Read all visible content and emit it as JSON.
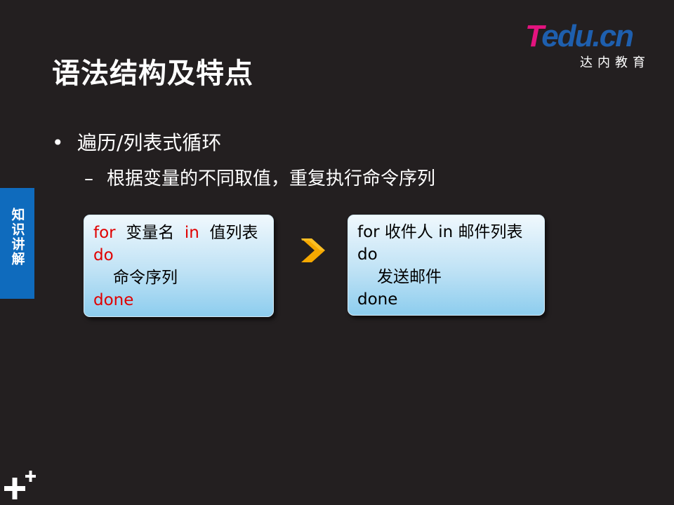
{
  "slide": {
    "title": "语法结构及特点"
  },
  "logo": {
    "brand_t": "T",
    "brand_rest": "edu.cn",
    "subtitle": "达内教育"
  },
  "content": {
    "bullet_marker": "•",
    "bullet_text": "遍历/列表式循环",
    "sub_marker": "–",
    "sub_text": "根据变量的不同取值，重复执行命令序列"
  },
  "side_tab": {
    "label": "知识讲解"
  },
  "syntax_box": {
    "line1_for": "for",
    "line1_var": "变量名",
    "line1_in": "in",
    "line1_list": "值列表",
    "line2_do": "do",
    "line3_cmd": "命令序列",
    "line4_done": "done"
  },
  "example_box": {
    "line1": "for 收件人 in 邮件列表",
    "line2": "do",
    "line3": "发送邮件",
    "line4": "done"
  },
  "colors": {
    "background": "#231f20",
    "keyword_red": "#e00000",
    "tab_blue": "#0f6bbd",
    "arrow_orange": "#f5a800",
    "logo_magenta": "#e4137f",
    "logo_blue": "#1e5fae"
  },
  "icons": {
    "arrow": "chevron-right-icon",
    "corner": "plus-icon"
  }
}
